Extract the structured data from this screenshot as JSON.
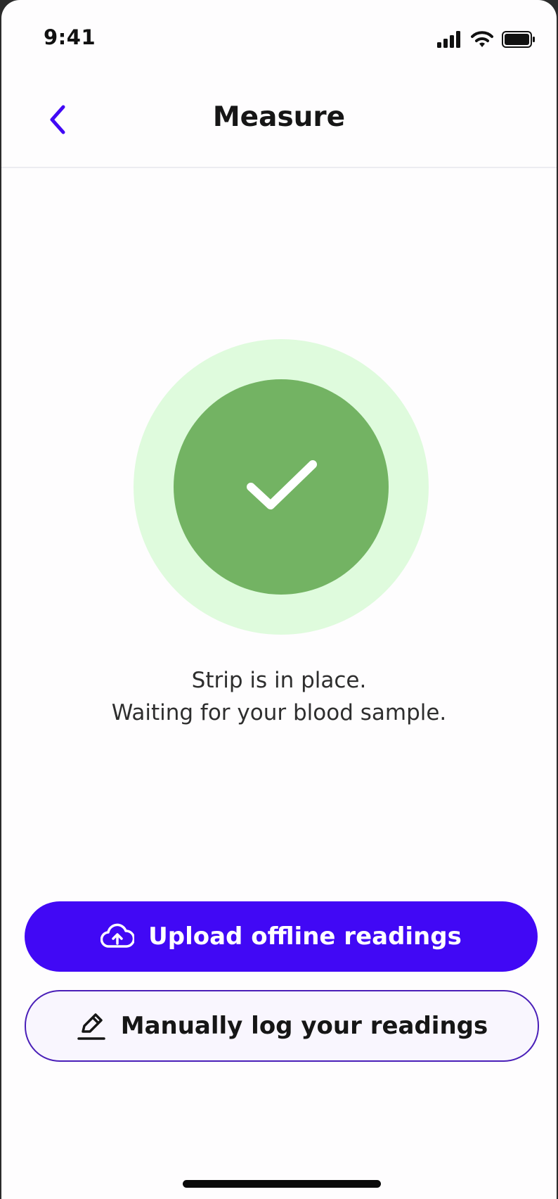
{
  "status_bar": {
    "time": "9:41"
  },
  "nav": {
    "title": "Measure",
    "back_icon": "chevron-left-icon"
  },
  "status": {
    "icon": "check-icon",
    "message_line1": "Strip is in place.",
    "message_line2": "Waiting for your blood sample."
  },
  "actions": {
    "upload_label": "Upload offline readings",
    "upload_icon": "cloud-upload-icon",
    "manual_label": "Manually log your readings",
    "manual_icon": "pencil-icon"
  },
  "colors": {
    "accent": "#4108f5",
    "success": "#73b363",
    "success_halo": "#dffbdd"
  }
}
